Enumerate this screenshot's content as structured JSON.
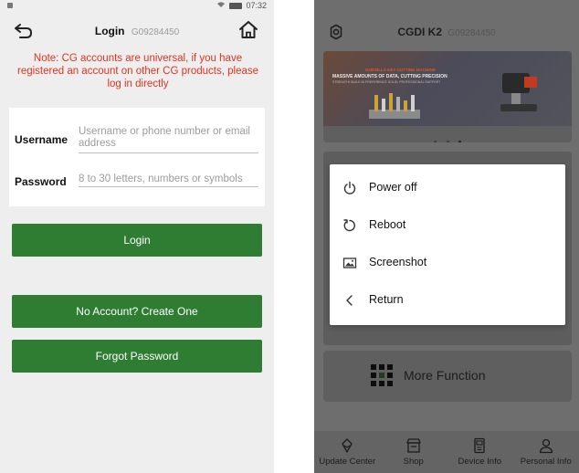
{
  "left": {
    "status": {
      "time": "07:32"
    },
    "header": {
      "title": "Login",
      "serial": "G09284450"
    },
    "note": "Note: CG accounts are universal, if you have registered an account on other CG products, please log in directly",
    "form": {
      "username_label": "Username",
      "username_placeholder": "Username or phone number or email address",
      "username_value": "",
      "password_label": "Password",
      "password_placeholder": "8 to 30 letters, numbers or symbols",
      "password_value": ""
    },
    "buttons": {
      "login": "Login",
      "create_account": "No Account? Create One",
      "forgot_password": "Forgot Password"
    },
    "colors": {
      "accent": "#2e7d32",
      "note": "#e0331f"
    }
  },
  "right": {
    "header": {
      "title": "CGDI K2",
      "serial": "G09284450"
    },
    "banner": {
      "line1": "GODZILLA KEY CUTTING MACHINE",
      "line2": "MASSIVE AMOUNTS OF DATA, CUTTING PRECISION",
      "line3": "STRENGTH BUILD IN PREFERENCE SOLID, PROFESSIONAL SUPPORT"
    },
    "popup_menu": [
      {
        "icon": "power-icon",
        "label": "Power off"
      },
      {
        "icon": "reboot-icon",
        "label": "Reboot"
      },
      {
        "icon": "screenshot-icon",
        "label": "Screenshot"
      },
      {
        "icon": "chevron-left-icon",
        "label": "Return"
      }
    ],
    "more_function": "More Function",
    "bottom_nav": [
      {
        "icon": "update-icon",
        "label": "Update Center"
      },
      {
        "icon": "shop-icon",
        "label": "Shop"
      },
      {
        "icon": "device-icon",
        "label": "Device Info"
      },
      {
        "icon": "person-icon",
        "label": "Personal Info"
      }
    ]
  }
}
